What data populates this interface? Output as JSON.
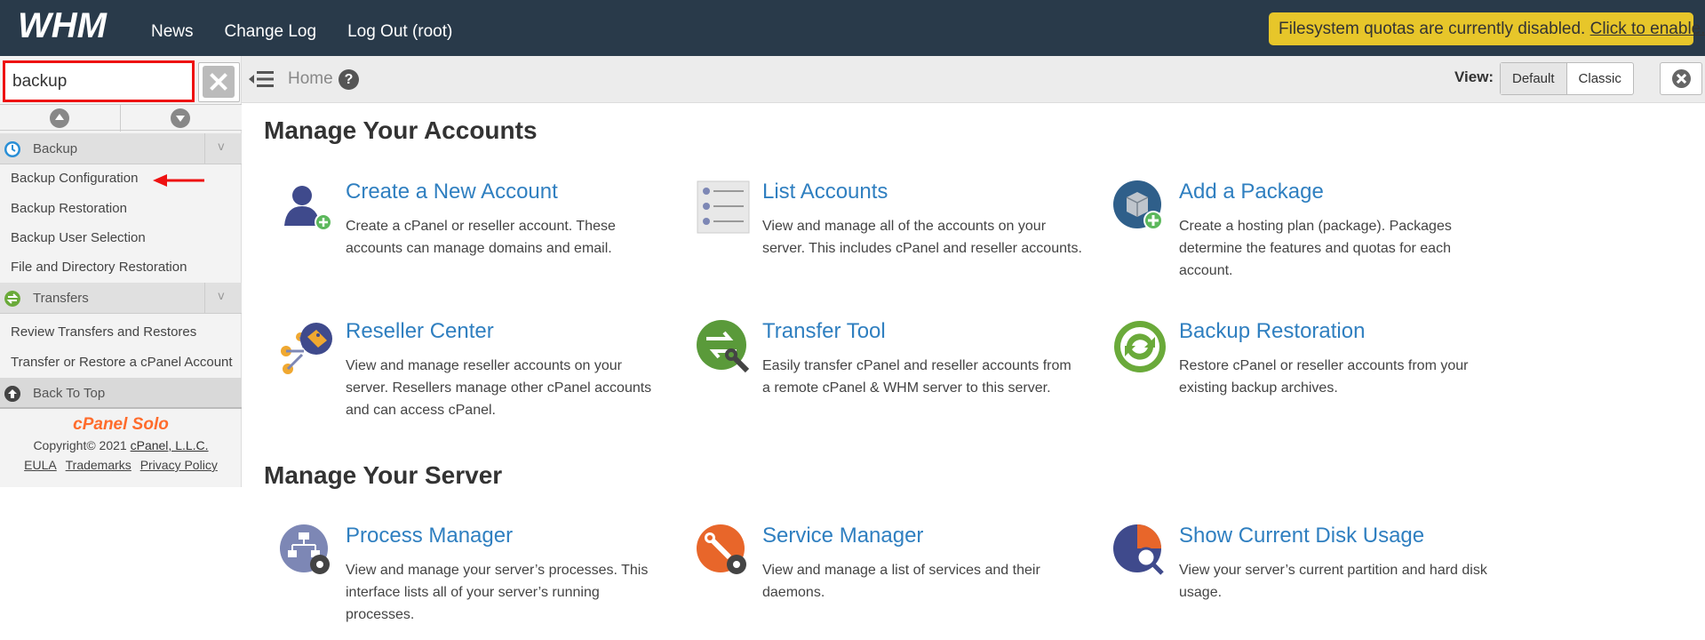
{
  "topbar": {
    "logo_text": "WHM",
    "nav": [
      "News",
      "Change Log",
      "Log Out (root)"
    ],
    "quota_text": "Filesystem quotas are currently disabled.",
    "quota_link": "Click to enable."
  },
  "sidebar": {
    "search_value": "backup",
    "categories": [
      {
        "label": "Backup",
        "items": [
          "Backup Configuration",
          "Backup Restoration",
          "Backup User Selection",
          "File and Directory Restoration"
        ]
      },
      {
        "label": "Transfers",
        "items": [
          "Review Transfers and Restores",
          "Transfer or Restore a cPanel Account"
        ]
      }
    ],
    "back_to_top": "Back To Top",
    "brand": "cPanel Solo",
    "copyright": "Copyright© 2021",
    "company": "cPanel, L.L.C.",
    "links": [
      "EULA",
      "Trademarks",
      "Privacy Policy"
    ]
  },
  "header": {
    "breadcrumb": "Home",
    "help": "?",
    "view_label": "View:",
    "view_options": [
      "Default",
      "Classic"
    ]
  },
  "main": {
    "sections": [
      {
        "title": "Manage Your Accounts",
        "tiles": [
          {
            "title": "Create a New Account",
            "desc": "Create a cPanel or reseller account. These accounts can manage domains and email."
          },
          {
            "title": "List Accounts",
            "desc": "View and manage all of the accounts on your server. This includes cPanel and reseller accounts."
          },
          {
            "title": "Add a Package",
            "desc": "Create a hosting plan (package). Packages determine the features and quotas for each account."
          },
          {
            "title": "Reseller Center",
            "desc": "View and manage reseller accounts on your server. Resellers manage other cPanel accounts and can access cPanel."
          },
          {
            "title": "Transfer Tool",
            "desc": "Easily transfer cPanel and reseller accounts from a remote cPanel & WHM server to this server."
          },
          {
            "title": "Backup Restoration",
            "desc": "Restore cPanel or reseller accounts from your existing backup archives."
          }
        ]
      },
      {
        "title": "Manage Your Server",
        "tiles": [
          {
            "title": "Process Manager",
            "desc": "View and manage your server’s processes. This interface lists all of your server’s running processes."
          },
          {
            "title": "Service Manager",
            "desc": "View and manage a list of services and their daemons."
          },
          {
            "title": "Show Current Disk Usage",
            "desc": "View your server’s current partition and hard disk usage."
          }
        ]
      }
    ]
  },
  "colors": {
    "topbar": "#293a4a",
    "accent_link": "#2f7fc0",
    "quota_banner": "#e7c62a",
    "highlight": "#e11111"
  }
}
